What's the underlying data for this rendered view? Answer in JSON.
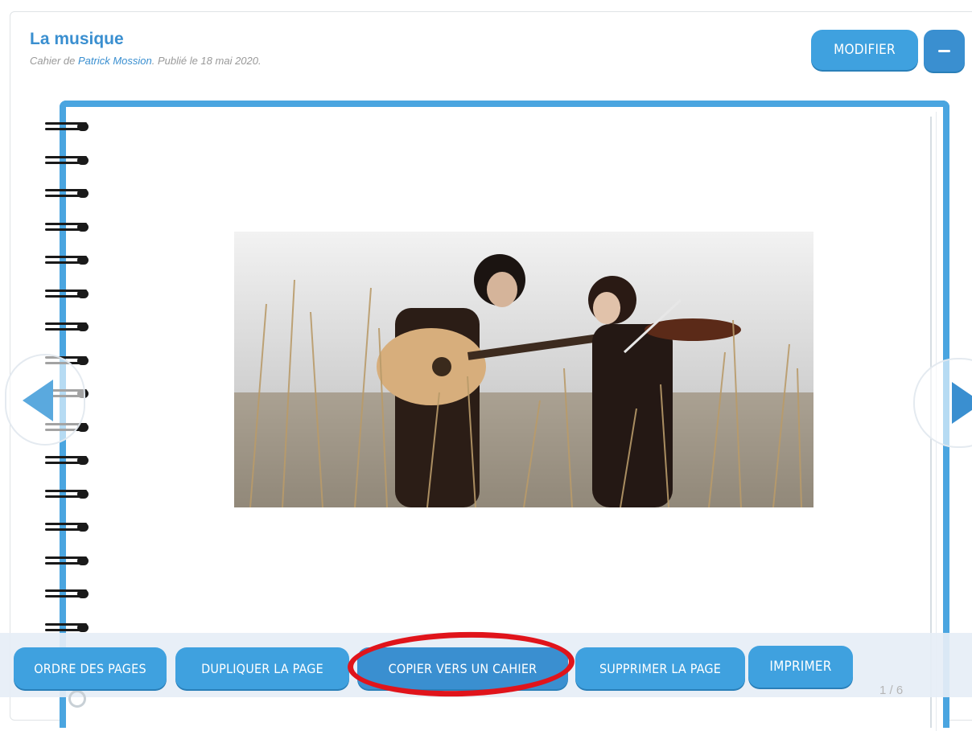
{
  "notebook": {
    "title": "La musique",
    "subtitle_prefix": "Cahier de ",
    "author": "Patrick Mossion",
    "subtitle_suffix": ". Publié le 18 mai 2020."
  },
  "header_actions": {
    "modify_label": "MODIFIER",
    "collapse_icon": "minus-icon"
  },
  "page": {
    "image_description_icon": "photo-musicians-guitar-violin",
    "counter": "1 / 6"
  },
  "navigation": {
    "previous_icon": "arrow-left-icon",
    "next_icon": "arrow-right-icon"
  },
  "toolbar": {
    "page_order_label": "ORDRE DES PAGES",
    "duplicate_label": "DUPLIQUER LA PAGE",
    "copy_to_notebook_label": "COPIER VERS UN CAHIER",
    "delete_label": "SUPPRIMER LA PAGE",
    "print_label": "IMPRIMER"
  },
  "colors": {
    "accent": "#3fa1df",
    "highlight": "#e0141b"
  }
}
